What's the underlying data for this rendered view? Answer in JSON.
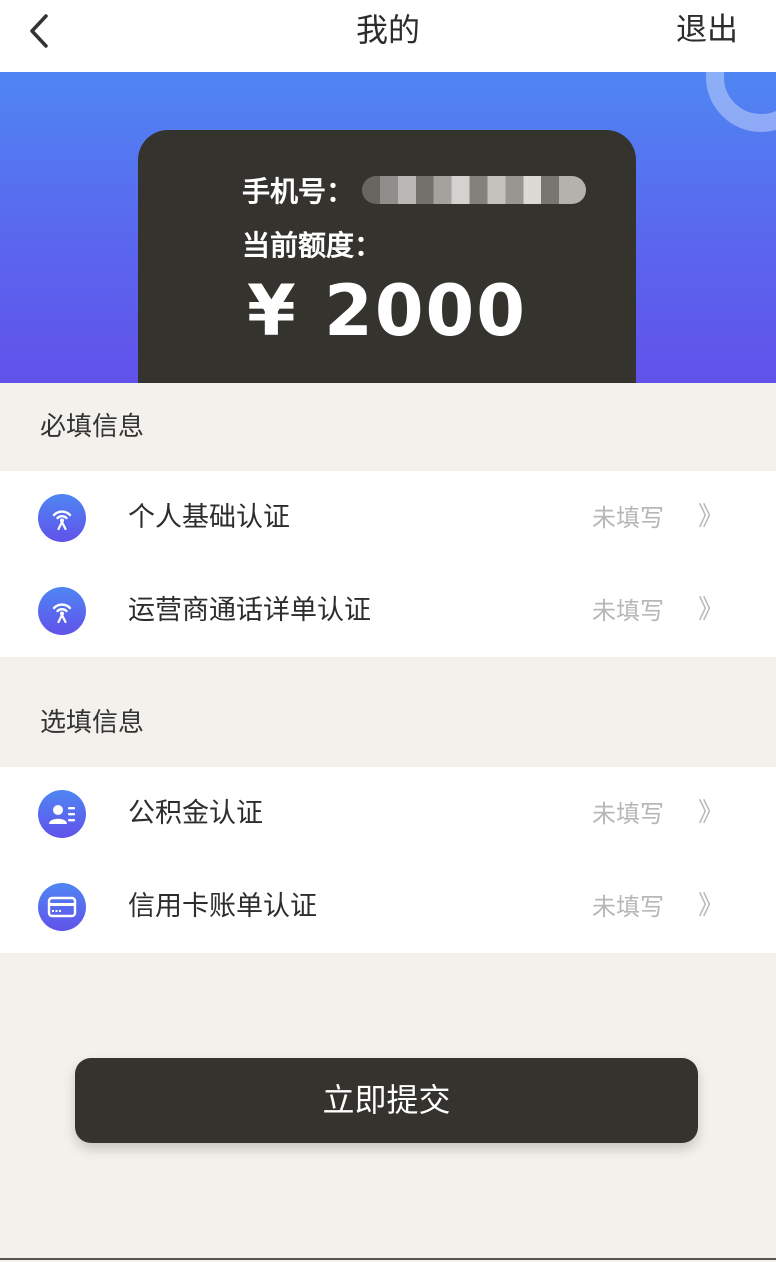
{
  "header": {
    "title": "我的",
    "logout_label": "退出",
    "back_icon": "chevron-left-icon"
  },
  "card": {
    "phone_label": "手机号：",
    "quota_label": "当前额度：",
    "amount": "¥ 2000"
  },
  "required": {
    "title": "必填信息",
    "items": [
      {
        "label": "个人基础认证",
        "status": "未填写",
        "arrow": "》",
        "icon": "signal-icon"
      },
      {
        "label": "运营商通话详单认证",
        "status": "未填写",
        "arrow": "》",
        "icon": "signal-icon"
      }
    ]
  },
  "optional": {
    "title": "选填信息",
    "items": [
      {
        "label": "公积金认证",
        "status": "未填写",
        "arrow": "》",
        "icon": "id-card-icon"
      },
      {
        "label": "信用卡账单认证",
        "status": "未填写",
        "arrow": "》",
        "icon": "credit-card-icon"
      }
    ]
  },
  "submit_label": "立即提交",
  "colors": {
    "brand_dark": "#35332d",
    "gradient_top": "#4f86f3",
    "gradient_bottom": "#6152ea",
    "page_bg": "#f3f1ec",
    "muted_text": "#b7b7b7"
  }
}
